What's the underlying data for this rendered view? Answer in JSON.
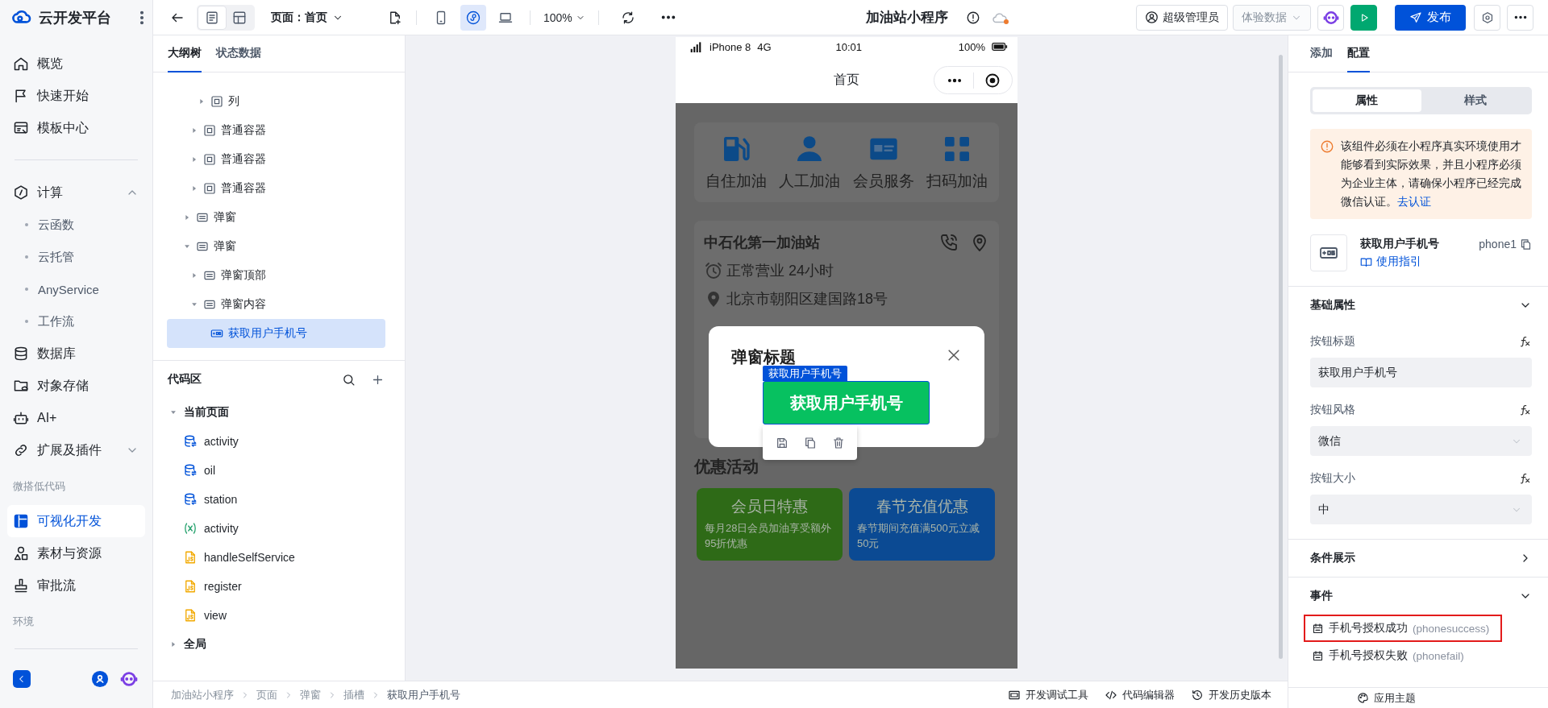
{
  "sidebar": {
    "logo": "云开发平台",
    "items": [
      {
        "kind": "item",
        "label": "概览",
        "selected": false
      },
      {
        "kind": "item",
        "label": "快速开始",
        "selected": false
      },
      {
        "kind": "item",
        "label": "模板中心",
        "selected": false
      },
      {
        "kind": "divider"
      },
      {
        "kind": "group",
        "label": "计算",
        "expanded": true,
        "selected": false
      },
      {
        "kind": "sub",
        "label": "云函数",
        "selected": false
      },
      {
        "kind": "sub",
        "label": "云托管",
        "selected": false
      },
      {
        "kind": "sub",
        "label": "AnyService",
        "selected": false
      },
      {
        "kind": "sub",
        "label": "工作流",
        "selected": false
      },
      {
        "kind": "item",
        "label": "数据库",
        "selected": false
      },
      {
        "kind": "item",
        "label": "对象存储",
        "selected": false
      },
      {
        "kind": "item",
        "label": "AI+",
        "selected": false
      },
      {
        "kind": "group",
        "label": "扩展及插件",
        "expanded": false,
        "selected": false
      },
      {
        "kind": "heading",
        "label": "微搭低代码"
      },
      {
        "kind": "item",
        "label": "可视化开发",
        "selected": true
      },
      {
        "kind": "item",
        "label": "素材与资源",
        "selected": false
      },
      {
        "kind": "item",
        "label": "审批流",
        "selected": false
      },
      {
        "kind": "heading",
        "label": "环境"
      }
    ]
  },
  "toolbar": {
    "view_modes": [
      {
        "selected": true
      },
      {
        "selected": false
      }
    ],
    "page_select": "页面：首页",
    "devices": [
      {
        "selected": false
      },
      {
        "selected": true
      },
      {
        "selected": false
      }
    ],
    "zoom": "100%",
    "app_title": "加油站小程序",
    "user": "超级管理员",
    "data_select": "体验数据",
    "publish": "发布"
  },
  "outline": {
    "tabs": [
      {
        "label": "大纲树",
        "selected": true
      },
      {
        "label": "状态数据",
        "selected": false
      }
    ],
    "tree": [
      {
        "children": [
          {
            "children": [
              {
                "label": "列",
                "kind": "container",
                "expanded": false,
                "selected": false
              }
            ]
          },
          {
            "label": "普通容器",
            "kind": "container",
            "expanded": false,
            "selected": false
          },
          {
            "label": "普通容器",
            "kind": "container",
            "expanded": false,
            "selected": false
          },
          {
            "label": "普通容器",
            "kind": "container",
            "expanded": false,
            "selected": false
          }
        ]
      },
      {
        "label": "弹窗",
        "kind": "popup",
        "expanded": false,
        "selected": false
      },
      {
        "label": "弹窗",
        "kind": "popup",
        "expanded": true,
        "selected": false,
        "children": [
          {
            "label": "弹窗顶部",
            "kind": "popup",
            "expanded": false,
            "selected": false
          },
          {
            "label": "弹窗内容",
            "kind": "popup",
            "expanded": true,
            "selected": false,
            "children": [
              {
                "label": "获取用户手机号",
                "kind": "phone",
                "selected": true
              }
            ]
          }
        ]
      }
    ]
  },
  "code": {
    "title": "代码区",
    "groups": [
      {
        "label": "当前页面",
        "expanded": true,
        "items": [
          {
            "kind": "datasource",
            "label": "activity"
          },
          {
            "kind": "datasource",
            "label": "oil"
          },
          {
            "kind": "datasource",
            "label": "station"
          },
          {
            "kind": "variable",
            "label": "activity"
          },
          {
            "kind": "script",
            "label": "handleSelfService"
          },
          {
            "kind": "script",
            "label": "register"
          },
          {
            "kind": "script",
            "label": "view"
          }
        ]
      },
      {
        "label": "全局",
        "expanded": false
      }
    ]
  },
  "phone": {
    "status": {
      "device": "iPhone 8",
      "network": "4G",
      "time": "10:01",
      "battery": "100%"
    },
    "title": "首页",
    "services": [
      "自住加油",
      "人工加油",
      "会员服务",
      "扫码加油"
    ],
    "station": {
      "name": "中石化第一加油站",
      "hours": "正常营业 24小时",
      "address": "北京市朝阳区建国路18号"
    },
    "section_title": "优惠活动",
    "promos": [
      {
        "title": "会员日特惠",
        "text": "每月28日会员加油享受额外95折优惠",
        "color": "#2e6a17"
      },
      {
        "title": "春节充值优惠",
        "text": "春节期间充值满500元立减50元",
        "color": "#0b4a93"
      }
    ],
    "modal": {
      "title": "弹窗标题",
      "selection_tag": "获取用户手机号",
      "button": "获取用户手机号"
    }
  },
  "inspector": {
    "tabs": [
      {
        "label": "添加",
        "selected": false
      },
      {
        "label": "配置",
        "selected": true
      }
    ],
    "modes": [
      {
        "label": "属性",
        "selected": true
      },
      {
        "label": "样式",
        "selected": false
      }
    ],
    "notice": {
      "text": "该组件必须在小程序真实环境使用才能够看到实际效果，并且小程序必须为企业主体，请确保小程序已经完成微信认证。",
      "link": "去认证"
    },
    "component": {
      "name": "获取用户手机号",
      "guide": "使用指引",
      "id": "phone1"
    },
    "sections": [
      {
        "title": "基础属性",
        "expanded": true,
        "fields": [
          {
            "kind": "input",
            "label": "按钮标题",
            "value": "获取用户手机号"
          },
          {
            "kind": "select",
            "label": "按钮风格",
            "value": "微信"
          },
          {
            "kind": "select",
            "label": "按钮大小",
            "value": "中"
          }
        ]
      },
      {
        "title": "条件展示",
        "expanded": false
      },
      {
        "title": "事件",
        "expanded": true,
        "events": [
          {
            "label": "手机号授权成功",
            "code": "(phonesuccess)",
            "highlighted": true
          },
          {
            "label": "手机号授权失败",
            "code": "(phonefail)",
            "highlighted": false
          }
        ]
      }
    ],
    "footer": "应用主题"
  },
  "status_bar": {
    "breadcrumb": [
      "加油站小程序",
      "页面",
      "弹窗",
      "插槽",
      "获取用户手机号"
    ],
    "tools": [
      "开发调试工具",
      "代码编辑器",
      "开发历史版本"
    ]
  }
}
